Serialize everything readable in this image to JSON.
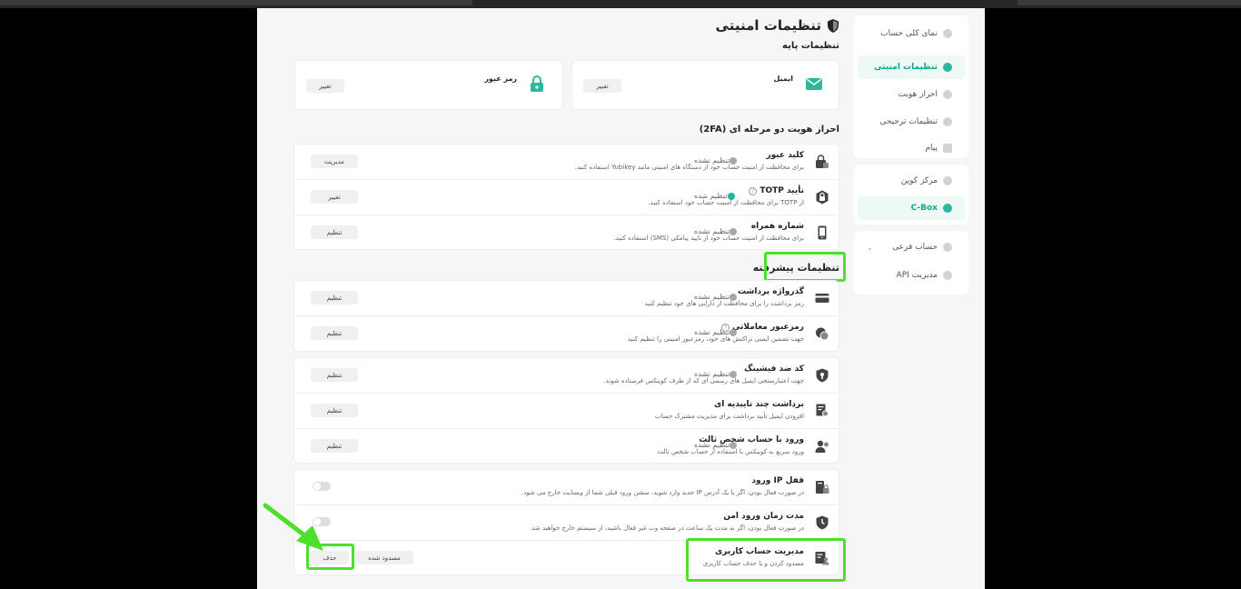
{
  "page_title": "تنظیمات امنیتی",
  "sidebar": {
    "group1": [
      {
        "label": "نمای کلی حساب",
        "icon": "pie-chart-icon"
      },
      {
        "label": "تنظیمات امنیتی",
        "icon": "shield-icon",
        "active": true
      },
      {
        "label": "احراز هویت",
        "icon": "id-icon"
      },
      {
        "label": "تنظیمات ترجیحی",
        "icon": "gear-icon"
      },
      {
        "label": "پیام",
        "icon": "message-icon"
      }
    ],
    "group2": [
      {
        "label": "مرکز کوپن",
        "icon": "coupon-icon"
      },
      {
        "label": "C-Box",
        "icon": "gift-icon",
        "active": true
      }
    ],
    "group3": [
      {
        "label": "حساب فرعی",
        "icon": "subaccount-icon"
      },
      {
        "label": "مدیریت API",
        "icon": "api-icon"
      }
    ]
  },
  "basic": {
    "heading": "تنظیمات پایه",
    "email": {
      "label": "ایمیل",
      "button": "تغییر"
    },
    "password": {
      "label": "رمز عبور",
      "button": "تغییر"
    }
  },
  "twofa": {
    "heading": "احراز هویت دو مرحله ای (2FA)",
    "rows": [
      {
        "title": "کلید عبور",
        "desc": "برای محافظت از امنیت حساب خود از دستگاه های امنیتی مانند Yubikey استفاده کنید.",
        "status": "تنظیم نشده",
        "button": "مدیریت"
      },
      {
        "title": "تأیید TOTP",
        "desc": "از TOTP برای محافظت از امنیت حساب خود استفاده کنید.",
        "status": "تنظیم شده",
        "button": "تغییر"
      },
      {
        "title": "شماره همراه",
        "desc": "برای محافظت از امنیت حساب خود از تایید پیامکی (SMS) استفاده کنید.",
        "status": "تنظیم نشده",
        "button": "تنظیم"
      }
    ]
  },
  "advanced": {
    "heading": "تنظیمات پیشرفته",
    "group1": [
      {
        "title": "گذرواژه برداشت",
        "desc": "رمز برداشت را برای محافظت از دارایی های خود تنظیم کنید",
        "status": "تنظیم نشده",
        "button": "تنظیم"
      },
      {
        "title": "رمزعبور معاملاتی",
        "desc": "جهت تضمین ایمنی تراکنش های خود، رمزعبور امنیتی را تنظیم کنید",
        "status": "تنظیم نشده",
        "button": "تنظیم"
      }
    ],
    "group2": [
      {
        "title": "کد ضد فیشینگ",
        "desc": "جهت اعتبارسنجی ایمیل های رسمی ای که از طرف کوینکس فرستاده شوند.",
        "status": "تنظیم نشده",
        "button": "تنظیم"
      },
      {
        "title": "برداشت چند تاییدیه ای",
        "desc": "افزودن ایمیل تأیید برداشت برای مدیریت مشترک حساب",
        "status": "",
        "button": "تنظیم"
      },
      {
        "title": "ورود با حساب شخص ثالث",
        "desc": "ورود سریع به کوینکس با استفاده از حساب شخص ثالث",
        "status": "تنظیم نشده",
        "button": "تنظیم"
      }
    ],
    "group3": [
      {
        "title": "قفل IP ورود",
        "desc": "در صورت فعال بودن، اگر با یک آدرس IP جدید وارد شوید، سشن ورود قبلی شما از وبسایت خارج می شود."
      },
      {
        "title": "مدت زمان ورود امن",
        "desc": "در صورت فعال بودن، اگر به مدت یک ساعت در صفحه وب غیر فعال باشید، از سیستم خارج خواهید شد."
      },
      {
        "title": "مدیریت حساب کاربری",
        "desc": "مسدود کردن و یا حذف حساب کاربری",
        "button_block": "مسدود شده",
        "button_delete": "حذف"
      }
    ]
  },
  "colors": {
    "accent": "#18b89a",
    "highlight": "#4be12b"
  }
}
